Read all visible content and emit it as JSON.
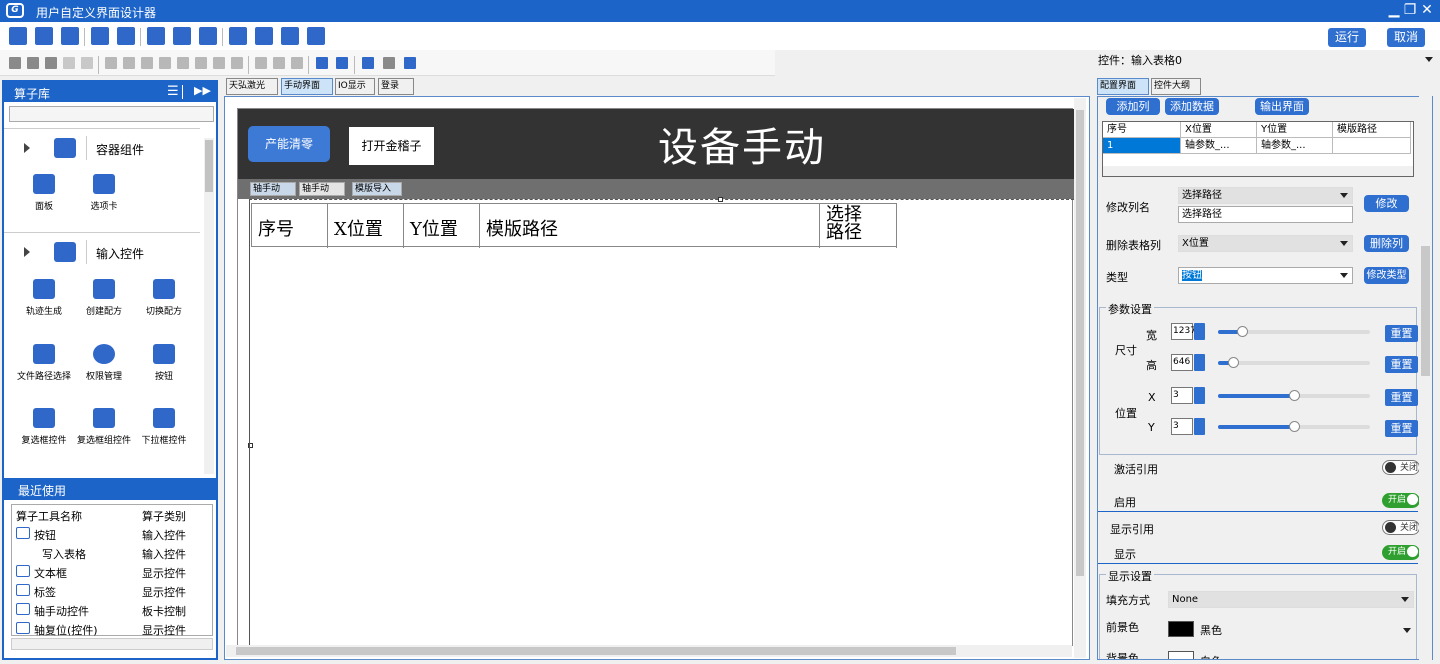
{
  "window": {
    "title": "用户自定义界面设计器",
    "logo_text": "G"
  },
  "toolbar": {
    "run_label": "运行",
    "cancel_label": "取消"
  },
  "control_label": "控件：输入表格0",
  "left": {
    "header": "算子库",
    "groups": [
      {
        "label": "容器组件",
        "items": [
          "面板",
          "选项卡"
        ]
      },
      {
        "label": "输入控件",
        "items": [
          "轨迹生成",
          "创建配方",
          "切换配方",
          "文件路径选择",
          "权限管理",
          "按钮",
          "复选框控件",
          "复选框组控件",
          "下拉框控件"
        ]
      }
    ],
    "recent_header": "最近使用",
    "recent_cols": [
      "算子工具名称",
      "算子类别"
    ],
    "recent_rows": [
      {
        "name": "按钮",
        "cat": "输入控件"
      },
      {
        "name": "写入表格",
        "cat": "输入控件"
      },
      {
        "name": "文本框",
        "cat": "显示控件"
      },
      {
        "name": "标签",
        "cat": "显示控件"
      },
      {
        "name": "轴手动控件",
        "cat": "板卡控制"
      },
      {
        "name": "轴复位(控件)",
        "cat": "显示控件"
      }
    ]
  },
  "center": {
    "tabs": [
      "天弘激光",
      "手动界面",
      "IO显示",
      "登录"
    ],
    "btn_clear": "产能清零",
    "btn_open": "打开金稽子",
    "big_title": "设备手动",
    "inner_tabs": [
      "轴手动",
      "轴手动",
      "模版导入"
    ],
    "table_headers": [
      "序号",
      "X位置",
      "Y位置",
      "模版路径",
      "选择\n路径"
    ]
  },
  "right": {
    "tabs": [
      "配置界面",
      "控件大纲"
    ],
    "btn_add_col": "添加列",
    "btn_add_data": "添加数据",
    "btn_export": "输出界面",
    "grid_headers": [
      "序号",
      "X位置",
      "Y位置",
      "模版路径"
    ],
    "grid_row": [
      "1",
      "轴参数_...",
      "轴参数_...",
      ""
    ],
    "rename_label": "修改列名",
    "rename_select": "选择路径",
    "rename_input": "选择路径",
    "rename_btn": "修改",
    "delcol_label": "删除表格列",
    "delcol_select": "X位置",
    "delcol_btn": "删除列",
    "type_label": "类型",
    "type_select": "按钮",
    "type_btn": "修改类型",
    "param_title": "参数设置",
    "size_label": "尺寸",
    "width_label": "宽",
    "width_val": "1237",
    "height_label": "高",
    "height_val": "646",
    "pos_label": "位置",
    "x_label": "X",
    "x_val": "3",
    "y_label": "Y",
    "y_val": "3",
    "reset_label": "重置",
    "slider_levels": [
      0.16,
      0.1,
      0.5,
      0.5
    ],
    "activate_ref_label": "激活引用",
    "activate_ref_state": "关闭",
    "enable_label": "启用",
    "enable_state": "开启",
    "display_ref_label": "显示引用",
    "display_ref_state": "关闭",
    "display_label": "显示",
    "display_state": "开启",
    "display_settings_title": "显示设置",
    "fill_label": "填充方式",
    "fill_value": "None",
    "fg_label": "前景色",
    "fg_value": "黑色",
    "bg_label": "背景色",
    "bg_value": "白色",
    "colors": {
      "fg": "#000000",
      "bg": "#ffffff"
    }
  },
  "colors": {
    "accent": "#1c64c8",
    "button": "#2f6fd0",
    "toggle_on": "#2fa02f",
    "canvas_dark": "#333333"
  }
}
